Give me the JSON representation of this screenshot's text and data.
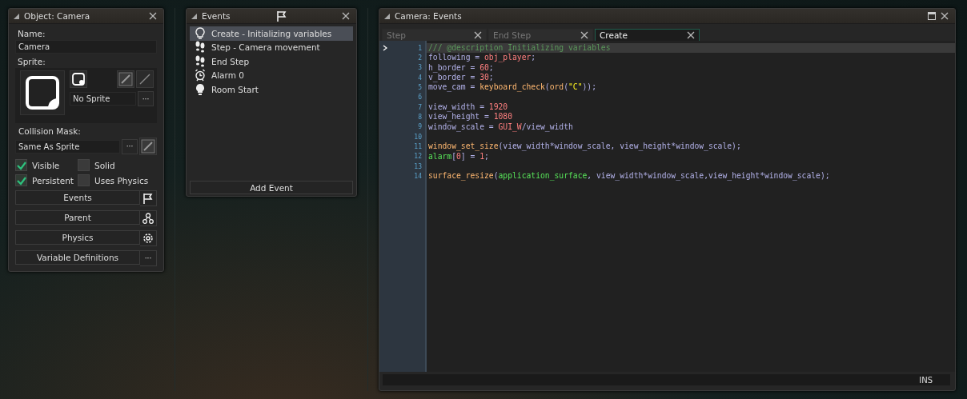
{
  "object_panel": {
    "title": "Object: Camera",
    "name_label": "Name:",
    "name_value": "Camera",
    "sprite_label": "Sprite:",
    "sprite_value": "No Sprite",
    "sprite_more": "···",
    "mask_label": "Collision Mask:",
    "mask_value": "Same As Sprite",
    "mask_more": "···",
    "checkboxes": [
      {
        "label": "Visible",
        "checked": true
      },
      {
        "label": "Solid",
        "checked": false
      },
      {
        "label": "Persistent",
        "checked": true
      },
      {
        "label": "Uses Physics",
        "checked": false
      }
    ],
    "buttons": [
      {
        "label": "Events",
        "kind": "flag"
      },
      {
        "label": "Parent",
        "kind": "nodes"
      },
      {
        "label": "Physics",
        "kind": "gear"
      },
      {
        "label": "Variable Definitions",
        "kind": "more",
        "extra": "···"
      }
    ]
  },
  "events_panel": {
    "title": "Events",
    "events": [
      {
        "label": "Create - Initializing variables",
        "kind": "bulb",
        "selected": true
      },
      {
        "label": "Step - Camera movement",
        "kind": "steps",
        "selected": false
      },
      {
        "label": "End Step",
        "kind": "steps",
        "selected": false
      },
      {
        "label": "Alarm 0",
        "kind": "alarm",
        "selected": false
      },
      {
        "label": "Room Start",
        "kind": "bulb-filled",
        "selected": false
      }
    ],
    "add_button": "Add Event"
  },
  "code_window": {
    "title": "Camera: Events",
    "tabs": [
      {
        "label": "Step",
        "selected": false
      },
      {
        "label": "End Step",
        "selected": false
      },
      {
        "label": "Create",
        "selected": true
      }
    ],
    "lines": [
      {
        "number": "1",
        "current": true,
        "tokens": [
          {
            "kind": "comment",
            "text": "/// @description Initializing variables"
          }
        ]
      },
      {
        "number": "2",
        "current": false,
        "tokens": [
          {
            "kind": "var",
            "text": "following = "
          },
          {
            "kind": "const",
            "text": "obj_player"
          },
          {
            "kind": "var",
            "text": ";"
          }
        ]
      },
      {
        "number": "3",
        "current": false,
        "tokens": [
          {
            "kind": "var",
            "text": "h_border = "
          },
          {
            "kind": "number",
            "text": "60"
          },
          {
            "kind": "var",
            "text": ";"
          }
        ]
      },
      {
        "number": "4",
        "current": false,
        "tokens": [
          {
            "kind": "var",
            "text": "v_border = "
          },
          {
            "kind": "number",
            "text": "30"
          },
          {
            "kind": "var",
            "text": ";"
          }
        ]
      },
      {
        "number": "5",
        "current": false,
        "tokens": [
          {
            "kind": "var",
            "text": "move_cam = "
          },
          {
            "kind": "func",
            "text": "keyboard_check"
          },
          {
            "kind": "var",
            "text": "("
          },
          {
            "kind": "func",
            "text": "ord"
          },
          {
            "kind": "var",
            "text": "("
          },
          {
            "kind": "string",
            "text": "\"C\""
          },
          {
            "kind": "var",
            "text": "));"
          }
        ]
      },
      {
        "number": "6",
        "current": false
      },
      {
        "number": "7",
        "current": false,
        "tokens": [
          {
            "kind": "var",
            "text": "view_width = "
          },
          {
            "kind": "number",
            "text": "1920"
          }
        ]
      },
      {
        "number": "8",
        "current": false,
        "tokens": [
          {
            "kind": "var",
            "text": "view_height = "
          },
          {
            "kind": "number",
            "text": "1080"
          }
        ]
      },
      {
        "number": "9",
        "current": false,
        "tokens": [
          {
            "kind": "var",
            "text": "window_scale = "
          },
          {
            "kind": "const",
            "text": "GUI_W"
          },
          {
            "kind": "var",
            "text": "/view_width"
          }
        ]
      },
      {
        "number": "10",
        "current": false
      },
      {
        "number": "11",
        "current": false,
        "tokens": [
          {
            "kind": "func",
            "text": "window_set_size"
          },
          {
            "kind": "var",
            "text": "(view_width*window_scale, view_height*window_scale);"
          }
        ]
      },
      {
        "number": "12",
        "current": false,
        "tokens": [
          {
            "kind": "builtin",
            "text": "alarm"
          },
          {
            "kind": "var",
            "text": "["
          },
          {
            "kind": "number",
            "text": "0"
          },
          {
            "kind": "var",
            "text": "] = "
          },
          {
            "kind": "number",
            "text": "1"
          },
          {
            "kind": "var",
            "text": ";"
          }
        ]
      },
      {
        "number": "13",
        "current": false
      },
      {
        "number": "14",
        "current": false,
        "tokens": [
          {
            "kind": "func",
            "text": "surface_resize"
          },
          {
            "kind": "var",
            "text": "("
          },
          {
            "kind": "builtin",
            "text": "application_surface"
          },
          {
            "kind": "var",
            "text": ", view_width*window_scale,view_height*window_scale);"
          }
        ]
      }
    ],
    "status": "INS"
  }
}
